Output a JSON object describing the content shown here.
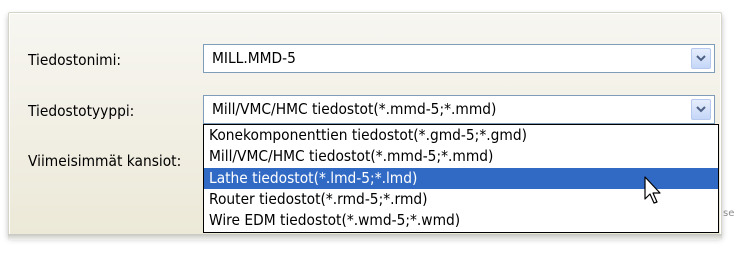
{
  "form": {
    "filename_label": "Tiedostonimi:",
    "filename_value": "MILL.MMD-5",
    "filetype_label": "Tiedostotyyppi:",
    "filetype_value": "Mill/VMC/HMC tiedostot(*.mmd-5;*.mmd)",
    "recent_label": "Viimeisimmät kansiot:"
  },
  "filetype_options": [
    "Konekomponenttien tiedostot(*.gmd-5;*.gmd)",
    "Mill/VMC/HMC tiedostot(*.mmd-5;*.mmd)",
    "Lathe tiedostot(*.lmd-5;*.lmd)",
    "Router tiedostot(*.rmd-5;*.rmd)",
    "Wire EDM tiedostot(*.wmd-5;*.wmd)"
  ],
  "highlighted_option_index": 2,
  "stray_text": "se",
  "colors": {
    "selection": "#316ac5",
    "field_border": "#7f9db9",
    "dialog_bg": "#ece9d8"
  }
}
